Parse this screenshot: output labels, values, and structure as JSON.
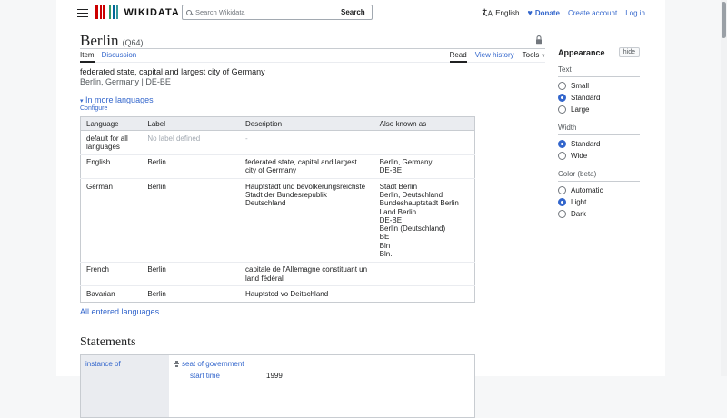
{
  "header": {
    "logo_text": "WIKIDATA",
    "search_placeholder": "Search Wikidata",
    "search_button": "Search",
    "language_label": "English",
    "donate_label": "Donate",
    "create_account_label": "Create account",
    "login_label": "Log in"
  },
  "page": {
    "title": "Berlin",
    "entity_id": "(Q64)",
    "tab_item": "Item",
    "tab_discussion": "Discussion",
    "view_read": "Read",
    "view_history": "View history",
    "view_tools": "Tools",
    "tools_chevron": "∨",
    "description": "federated state, capital and largest city of Germany",
    "alias_line": "Berlin, Germany | DE-BE",
    "more_languages_arrow": "▾",
    "more_languages": "In more languages",
    "configure": "Configure",
    "all_entered_languages": "All entered languages"
  },
  "language_table": {
    "headers": [
      "Language",
      "Label",
      "Description",
      "Also known as"
    ],
    "rows": [
      {
        "language": "default for all languages",
        "label": "No label defined",
        "label_muted": true,
        "description": "-",
        "desc_muted": true,
        "aliases": []
      },
      {
        "language": "English",
        "label": "Berlin",
        "label_muted": false,
        "description": "federated state, capital and largest city of Germany",
        "desc_muted": false,
        "aliases": [
          "Berlin, Germany",
          "DE-BE"
        ]
      },
      {
        "language": "German",
        "label": "Berlin",
        "label_muted": false,
        "description": "Hauptstadt und bevölkerungsreichste Stadt der Bundesrepublik Deutschland",
        "desc_muted": false,
        "aliases": [
          "Stadt Berlin",
          "Berlin, Deutschland",
          "Bundeshauptstadt Berlin",
          "Land Berlin",
          "DE-BE",
          "Berlin (Deutschland)",
          "BE",
          "Bln",
          "Bln."
        ]
      },
      {
        "language": "French",
        "label": "Berlin",
        "label_muted": false,
        "description": "capitale de l'Allemagne constituant un land fédéral",
        "desc_muted": false,
        "aliases": []
      },
      {
        "language": "Bavarian",
        "label": "Berlin",
        "label_muted": false,
        "description": "Hauptstod vo Deitschland",
        "desc_muted": false,
        "aliases": []
      }
    ]
  },
  "statements": {
    "heading": "Statements",
    "items": [
      {
        "property": "instance of",
        "mainsnak": "seat of government",
        "qualifiers": [
          {
            "property": "start time",
            "value": "1999"
          }
        ]
      }
    ]
  },
  "appearance": {
    "heading": "Appearance",
    "hide_label": "hide",
    "sections": [
      {
        "label": "Text",
        "options": [
          {
            "label": "Small",
            "selected": false
          },
          {
            "label": "Standard",
            "selected": true
          },
          {
            "label": "Large",
            "selected": false
          }
        ]
      },
      {
        "label": "Width",
        "options": [
          {
            "label": "Standard",
            "selected": true
          },
          {
            "label": "Wide",
            "selected": false
          }
        ]
      },
      {
        "label": "Color (beta)",
        "options": [
          {
            "label": "Automatic",
            "selected": false
          },
          {
            "label": "Light",
            "selected": true
          },
          {
            "label": "Dark",
            "selected": false
          }
        ]
      }
    ]
  },
  "colors": {
    "link": "#3366cc",
    "accent": "#3366cc",
    "page_background": "#f6f7f8",
    "panel_background": "#ffffff",
    "table_header_background": "#eaecf0",
    "property_cell_background": "#eaecf0",
    "border": "#c8ccd1",
    "muted_text": "#72777d",
    "logo_red": "#cc0000",
    "logo_green": "#339966",
    "logo_blue": "#006699"
  },
  "icons": {
    "menu": "hamburger",
    "search": "magnifier",
    "language": "lang-glyph",
    "donate": "heart",
    "protection": "padlock",
    "rank": "rank-selector",
    "expand": "triangle-down"
  }
}
